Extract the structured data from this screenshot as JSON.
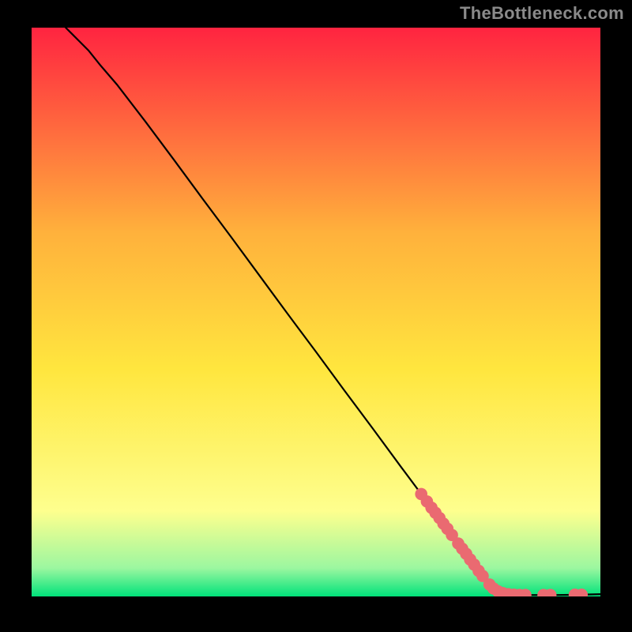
{
  "attribution": "TheBottleneck.com",
  "colors": {
    "bg": "#000000",
    "curve": "#000000",
    "marker": "#ea6a71",
    "grad_top": "#ff2440",
    "grad_mid_upper": "#ffb13c",
    "grad_mid": "#ffe63e",
    "grad_yellow_pale": "#feff8e",
    "grad_green_pale": "#9cf7a0",
    "grad_green": "#00e27a"
  },
  "chart_data": {
    "type": "line",
    "title": "",
    "xlabel": "",
    "ylabel": "",
    "xlim": [
      0,
      100
    ],
    "ylim": [
      0,
      100
    ],
    "curve": [
      {
        "x": 6,
        "y": 100
      },
      {
        "x": 7,
        "y": 99
      },
      {
        "x": 8.5,
        "y": 97.5
      },
      {
        "x": 10,
        "y": 96
      },
      {
        "x": 12,
        "y": 93.5
      },
      {
        "x": 15,
        "y": 90
      },
      {
        "x": 20,
        "y": 83.5
      },
      {
        "x": 25,
        "y": 76.8
      },
      {
        "x": 30,
        "y": 70
      },
      {
        "x": 35,
        "y": 63.3
      },
      {
        "x": 40,
        "y": 56.5
      },
      {
        "x": 45,
        "y": 49.7
      },
      {
        "x": 50,
        "y": 43
      },
      {
        "x": 55,
        "y": 36.2
      },
      {
        "x": 60,
        "y": 29.5
      },
      {
        "x": 65,
        "y": 22.7
      },
      {
        "x": 70,
        "y": 16
      },
      {
        "x": 75,
        "y": 9.2
      },
      {
        "x": 79,
        "y": 3.7
      },
      {
        "x": 81,
        "y": 1.6
      },
      {
        "x": 82.5,
        "y": 0.8
      },
      {
        "x": 84,
        "y": 0.4
      },
      {
        "x": 88,
        "y": 0.25
      },
      {
        "x": 92,
        "y": 0.25
      },
      {
        "x": 96,
        "y": 0.3
      },
      {
        "x": 100,
        "y": 0.4
      }
    ],
    "markers": [
      {
        "x": 68.5,
        "y": 18.0
      },
      {
        "x": 69.5,
        "y": 16.7
      },
      {
        "x": 70.3,
        "y": 15.6
      },
      {
        "x": 71.0,
        "y": 14.7
      },
      {
        "x": 71.7,
        "y": 13.8
      },
      {
        "x": 72.4,
        "y": 12.8
      },
      {
        "x": 73.1,
        "y": 11.9
      },
      {
        "x": 73.9,
        "y": 10.8
      },
      {
        "x": 75.0,
        "y": 9.3
      },
      {
        "x": 75.7,
        "y": 8.4
      },
      {
        "x": 76.4,
        "y": 7.5
      },
      {
        "x": 77.1,
        "y": 6.5
      },
      {
        "x": 77.8,
        "y": 5.6
      },
      {
        "x": 78.6,
        "y": 4.5
      },
      {
        "x": 79.3,
        "y": 3.6
      },
      {
        "x": 80.5,
        "y": 2.1
      },
      {
        "x": 81.2,
        "y": 1.4
      },
      {
        "x": 82.0,
        "y": 0.9
      },
      {
        "x": 82.8,
        "y": 0.6
      },
      {
        "x": 83.8,
        "y": 0.4
      },
      {
        "x": 84.8,
        "y": 0.3
      },
      {
        "x": 85.8,
        "y": 0.25
      },
      {
        "x": 86.8,
        "y": 0.25
      },
      {
        "x": 90.0,
        "y": 0.25
      },
      {
        "x": 91.2,
        "y": 0.25
      },
      {
        "x": 95.5,
        "y": 0.3
      },
      {
        "x": 96.7,
        "y": 0.3
      }
    ]
  }
}
